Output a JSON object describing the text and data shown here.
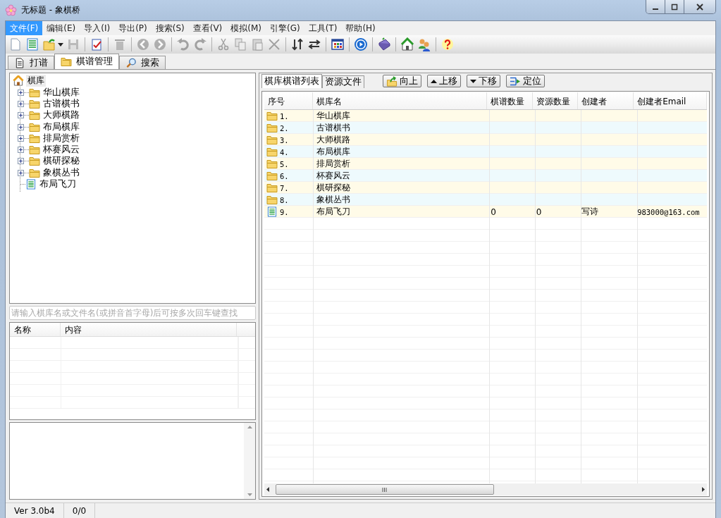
{
  "window": {
    "title": "无标题 - 象棋桥"
  },
  "menu": [
    {
      "label": "文件(F)",
      "selected": true
    },
    {
      "label": "编辑(E)",
      "selected": false
    },
    {
      "label": "导入(I)",
      "selected": false
    },
    {
      "label": "导出(P)",
      "selected": false
    },
    {
      "label": "搜索(S)",
      "selected": false
    },
    {
      "label": "查看(V)",
      "selected": false
    },
    {
      "label": "模拟(M)",
      "selected": false
    },
    {
      "label": "引擎(G)",
      "selected": false
    },
    {
      "label": "工具(T)",
      "selected": false
    },
    {
      "label": "帮助(H)",
      "selected": false
    }
  ],
  "main_tabs": [
    {
      "label": "打谱",
      "selected": false,
      "kind": "document"
    },
    {
      "label": "棋谱管理",
      "selected": true,
      "kind": "folder"
    },
    {
      "label": "搜索",
      "selected": false,
      "kind": "magnifier"
    }
  ],
  "tree": {
    "label": "棋库",
    "children": [
      {
        "label": "华山棋库",
        "kind": "folder",
        "expanded": false
      },
      {
        "label": "古谱棋书",
        "kind": "folder",
        "expanded": false
      },
      {
        "label": "大师棋路",
        "kind": "folder",
        "expanded": false
      },
      {
        "label": "布局棋库",
        "kind": "folder",
        "expanded": false
      },
      {
        "label": "排局赏析",
        "kind": "folder",
        "expanded": false
      },
      {
        "label": "杯赛风云",
        "kind": "folder",
        "expanded": false
      },
      {
        "label": "棋研探秘",
        "kind": "folder",
        "expanded": false
      },
      {
        "label": "象棋丛书",
        "kind": "folder",
        "expanded": false
      },
      {
        "label": "布局飞刀",
        "kind": "file"
      }
    ]
  },
  "search_field": {
    "placeholder": "请输入棋库名或文件名(或拼音首字母)后可按多次回车键查找"
  },
  "property_table": {
    "columns": [
      "名称",
      "内容"
    ]
  },
  "right_tabs": [
    {
      "label": "棋库棋谱列表",
      "selected": true
    },
    {
      "label": "资源文件",
      "selected": false
    }
  ],
  "buttons": [
    {
      "label": "向上",
      "kind": "up-folder"
    },
    {
      "label": "上移",
      "kind": "move-up"
    },
    {
      "label": "下移",
      "kind": "move-down"
    },
    {
      "label": "定位",
      "kind": "locate"
    }
  ],
  "table": {
    "columns": [
      "序号",
      "棋库名",
      "棋谱数量",
      "资源数量",
      "创建者",
      "创建者Email"
    ],
    "rows": [
      {
        "kind": "folder",
        "index": "1.",
        "name": "华山棋库"
      },
      {
        "kind": "folder",
        "index": "2.",
        "name": "古谱棋书"
      },
      {
        "kind": "folder",
        "index": "3.",
        "name": "大师棋路"
      },
      {
        "kind": "folder",
        "index": "4.",
        "name": "布局棋库"
      },
      {
        "kind": "folder",
        "index": "5.",
        "name": "排局赏析"
      },
      {
        "kind": "folder",
        "index": "6.",
        "name": "杯赛风云"
      },
      {
        "kind": "folder",
        "index": "7.",
        "name": "棋研探秘"
      },
      {
        "kind": "folder",
        "index": "8.",
        "name": "象棋丛书"
      },
      {
        "kind": "file",
        "index": "9.",
        "name": "布局飞刀",
        "games": "0",
        "resources": "0",
        "creator": "写诗",
        "email": "983000@163.com"
      }
    ]
  },
  "status_bar": [
    "Ver 3.0b4",
    "0/0"
  ]
}
